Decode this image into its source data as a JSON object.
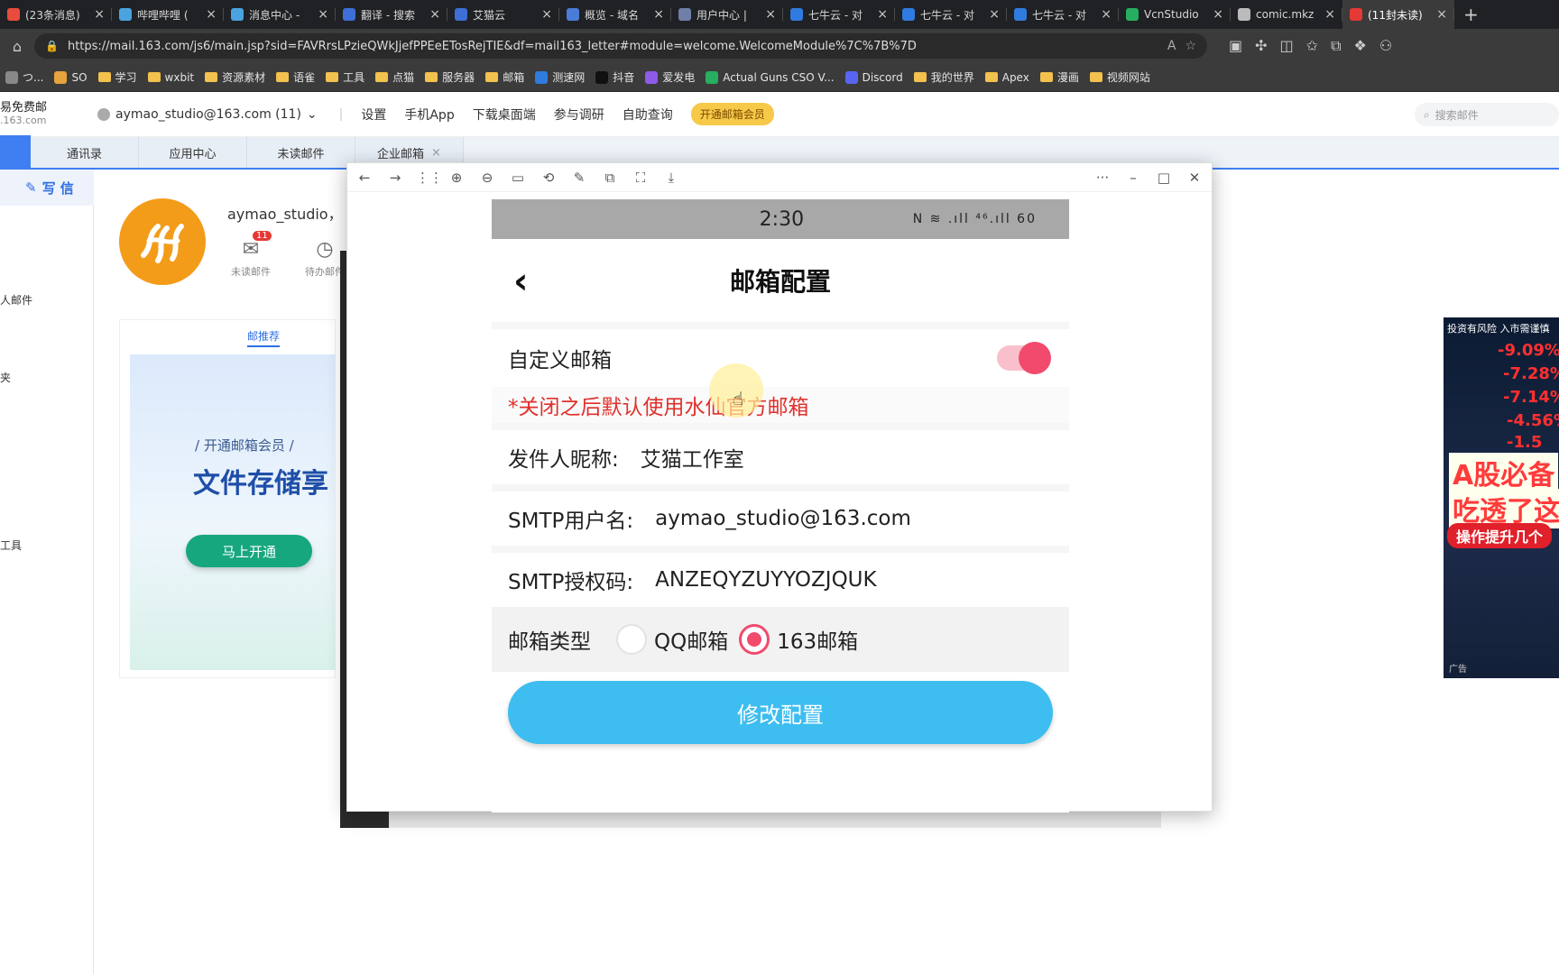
{
  "browser": {
    "tabs": [
      {
        "title": "(23条消息)",
        "color": "#e74c3c",
        "active": false
      },
      {
        "title": "哔哩哔哩 (",
        "color": "#4aa3df",
        "active": false
      },
      {
        "title": "消息中心 -",
        "color": "#4aa3df",
        "active": false
      },
      {
        "title": "翻译 - 搜索",
        "color": "#3d6fd6",
        "active": false
      },
      {
        "title": "艾猫云",
        "color": "#3d6fd6",
        "active": false
      },
      {
        "title": "概览 - 域名",
        "color": "#4a7bd6",
        "active": false
      },
      {
        "title": "用户中心 |",
        "color": "#6f7fa8",
        "active": false
      },
      {
        "title": "七牛云 - 对",
        "color": "#2f7be0",
        "active": false
      },
      {
        "title": "七牛云 - 对",
        "color": "#2f7be0",
        "active": false
      },
      {
        "title": "七牛云 - 对",
        "color": "#2f7be0",
        "active": false
      },
      {
        "title": "VcnStudio",
        "color": "#27ae60",
        "active": false
      },
      {
        "title": "comic.mkz",
        "color": "#bbbbbb",
        "active": false
      },
      {
        "title": "(11封未读)",
        "color": "#e53935",
        "active": true
      }
    ],
    "new_tab": "+",
    "url": "https://mail.163.com/js6/main.jsp?sid=FAVRrsLPzieQWkJjefPPEeETosRejTIE&df=mail163_letter#module=welcome.WelcomeModule%7C%7B%7D",
    "bookmarks": [
      {
        "label": "つ...",
        "kind": "sq",
        "color": "#888888"
      },
      {
        "label": "SO",
        "kind": "sq",
        "color": "#e6a23c"
      },
      {
        "label": "学习",
        "kind": "folder"
      },
      {
        "label": "wxbit",
        "kind": "folder"
      },
      {
        "label": "资源素材",
        "kind": "folder"
      },
      {
        "label": "语雀",
        "kind": "folder"
      },
      {
        "label": "工具",
        "kind": "folder"
      },
      {
        "label": "点猫",
        "kind": "folder"
      },
      {
        "label": "服务器",
        "kind": "folder"
      },
      {
        "label": "邮箱",
        "kind": "folder"
      },
      {
        "label": "测速网",
        "kind": "sq",
        "color": "#2f7be0"
      },
      {
        "label": "抖音",
        "kind": "sq",
        "color": "#111111"
      },
      {
        "label": "爱发电",
        "kind": "sq",
        "color": "#8e5be8"
      },
      {
        "label": "Actual Guns CSO V...",
        "kind": "sq",
        "color": "#27ae60"
      },
      {
        "label": "Discord",
        "kind": "sq",
        "color": "#5865f2"
      },
      {
        "label": "我的世界",
        "kind": "folder"
      },
      {
        "label": "Apex",
        "kind": "folder"
      },
      {
        "label": "漫画",
        "kind": "folder"
      },
      {
        "label": "视频网站",
        "kind": "folder"
      }
    ]
  },
  "mail": {
    "logo_line1": "易免费邮",
    "logo_line2": ".163.com",
    "account": "aymao_studio@163.com (11)",
    "links": [
      "设置",
      "手机App",
      "下载桌面端",
      "参与调研",
      "自助查询"
    ],
    "vip": "开通邮箱会员",
    "search_placeholder": "搜索邮件",
    "tabs": [
      "通讯录",
      "应用中心",
      "未读邮件",
      "企业邮箱"
    ],
    "compose": "写 信",
    "side_items": [
      "人邮件",
      "夹",
      "工具"
    ],
    "greeting": "aymao_studio，",
    "unread_label": "未读邮件",
    "unread_count": "11",
    "todo_label": "待办邮件",
    "reco_tab": "邮推荐",
    "banner_sub": "/ 开通邮箱会员 /",
    "banner_title": "文件存储享",
    "banner_btn": "马上开通"
  },
  "ad": {
    "risk": "投资有风险 入市需谨慎",
    "nums": [
      "-9.09%",
      "-7.28%",
      "-7.14%",
      "-4.56%",
      "-1.5"
    ],
    "big1": "A股必备",
    "big2": "吃透了这",
    "cta": "操作提升几个",
    "tag": "广告"
  },
  "phone": {
    "time": "2:30",
    "status_icons": "N ≋ .ıll ⁴⁶.ıll 60",
    "title": "邮箱配置",
    "custom_mailbox_label": "自定义邮箱",
    "custom_mailbox_enabled": true,
    "warning": "*关闭之后默认使用水仙官方邮箱",
    "sender_label": "发件人昵称:",
    "sender_value": "艾猫工作室",
    "smtp_user_label": "SMTP用户名:",
    "smtp_user_value": "aymao_studio@163.com",
    "smtp_code_label": "SMTP授权码:",
    "smtp_code_value": "ANZEQYZUYYOZJQUK",
    "type_label": "邮箱类型",
    "type_options": [
      "QQ邮箱",
      "163邮箱"
    ],
    "type_selected": "163邮箱",
    "submit": "修改配置"
  }
}
